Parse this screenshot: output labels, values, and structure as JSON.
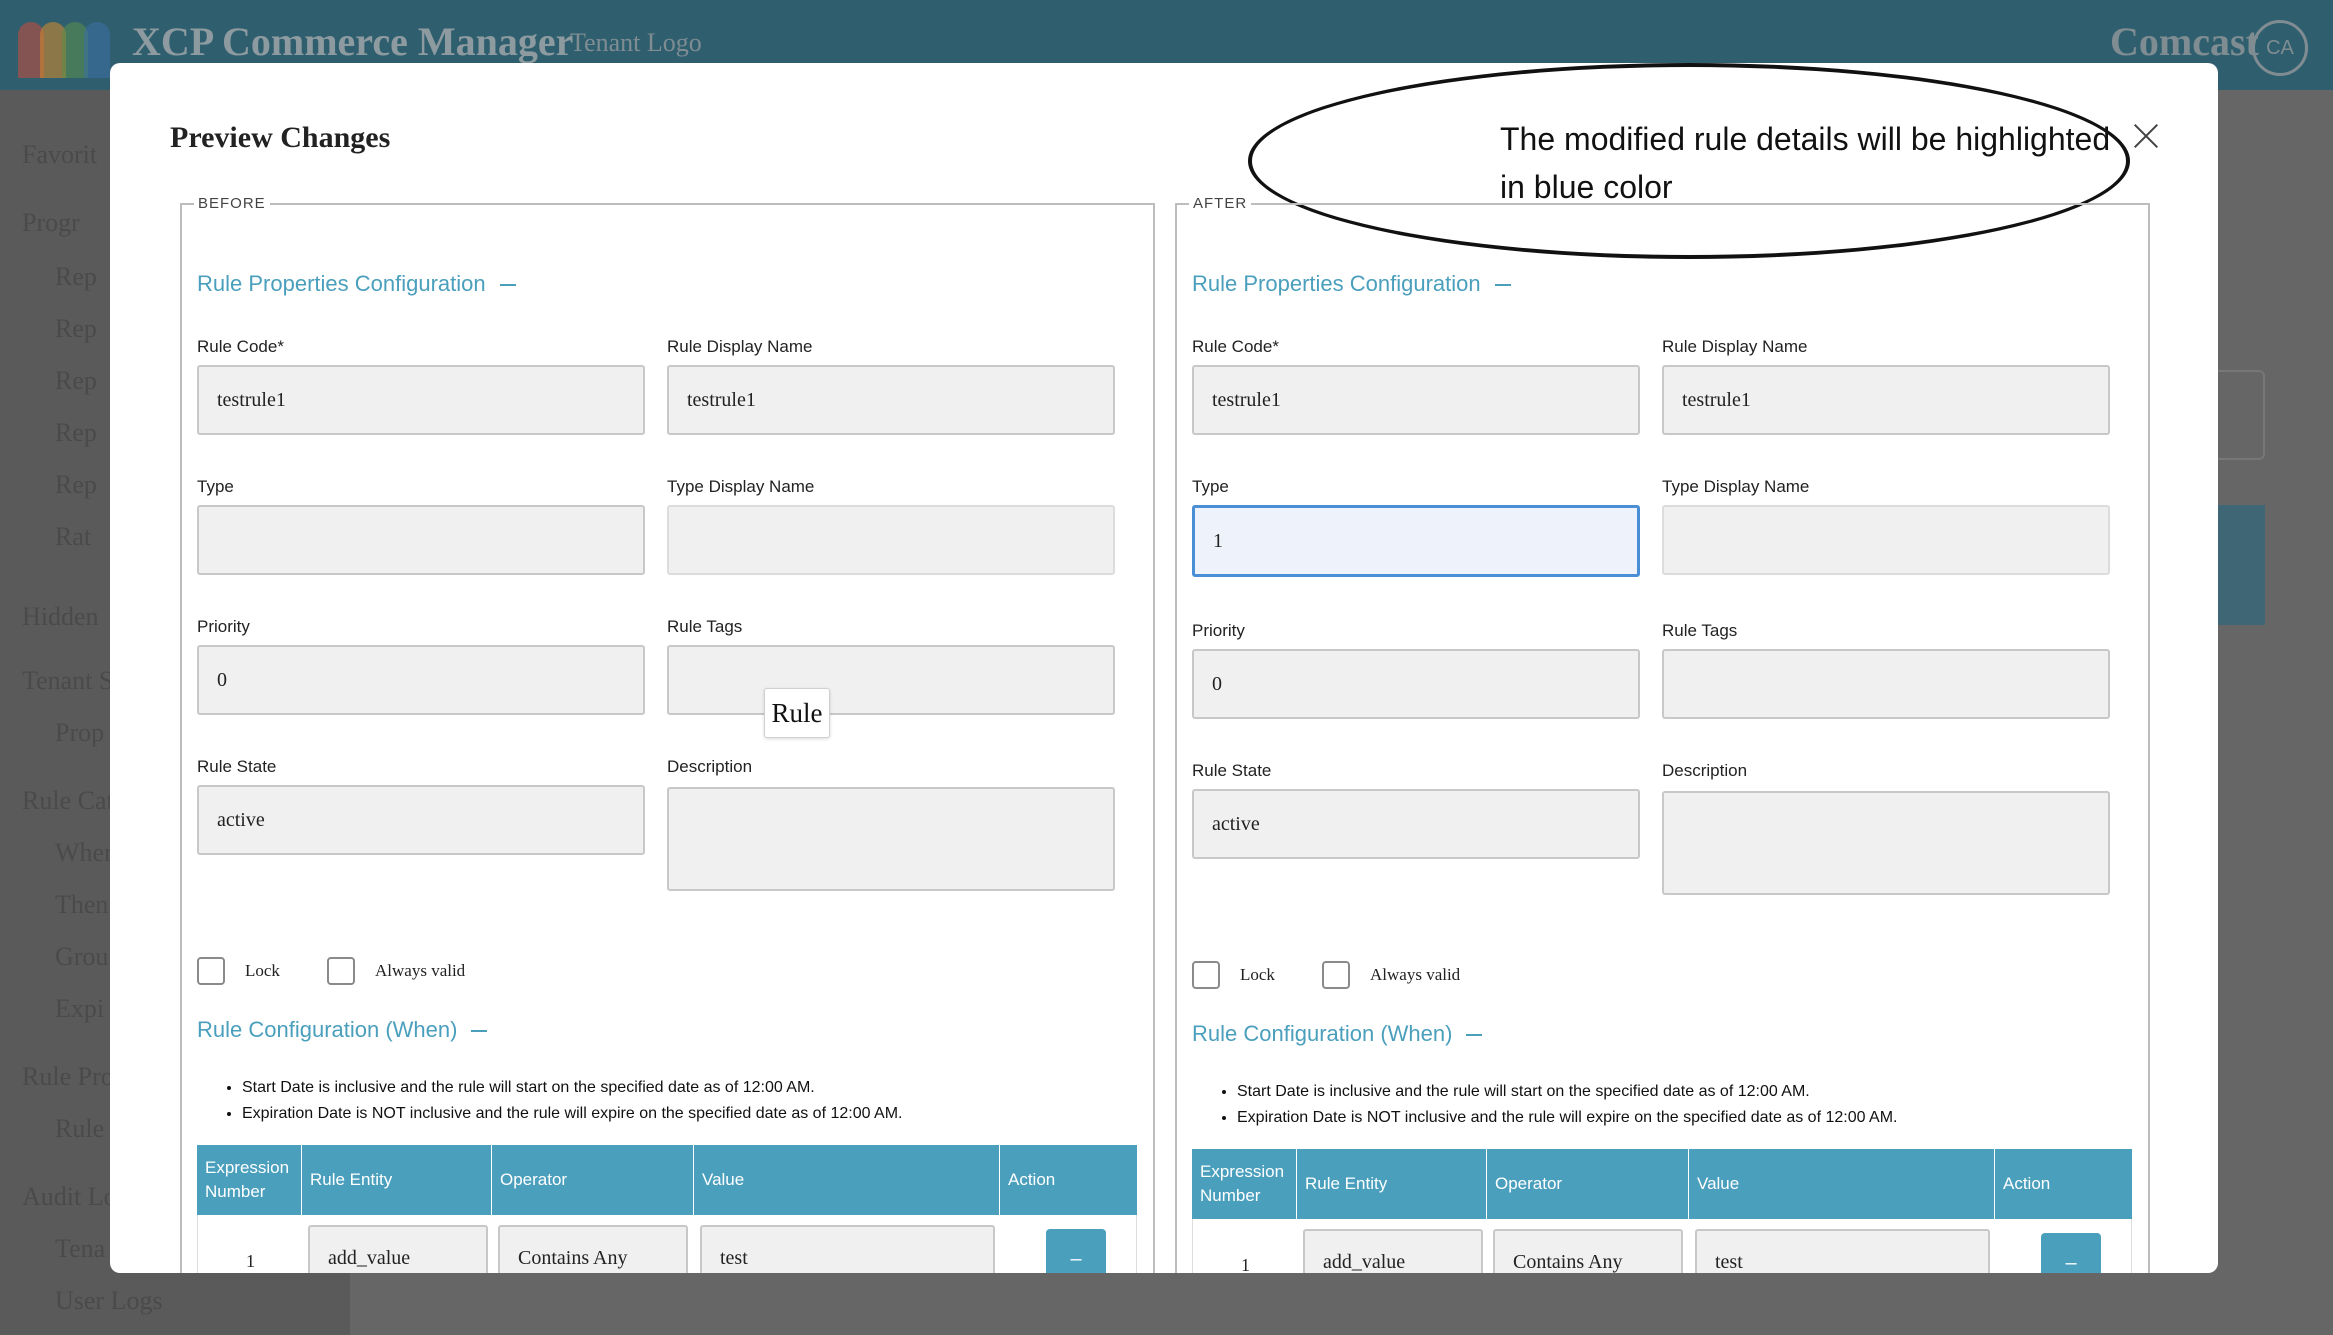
{
  "app": {
    "title": "XCP Commerce Manager",
    "header_link": "Tenant Logo",
    "brand": "Comcast",
    "avatar": "CA",
    "sidebar_items": [
      "Favorit",
      "Progr",
      "Rep",
      "Rep",
      "Rep",
      "Rep",
      "Rep",
      "Rat",
      "Hidden",
      "Tenant S",
      "Prop",
      "Rule Cat",
      "Wher",
      "Then",
      "Grou",
      "Expi",
      "Rule Pro",
      "Rule",
      "Audit Lo",
      "Tena",
      "User Logs"
    ]
  },
  "modal": {
    "title": "Preview Changes",
    "callout": "The modified rule details will be highlighted in blue color",
    "tooltip": "Rule"
  },
  "panes": {
    "before": {
      "legend": "BEFORE",
      "section_properties": "Rule Properties Configuration",
      "labels": {
        "rule_code": "Rule Code*",
        "rule_display_name": "Rule Display Name",
        "type": "Type",
        "type_display_name": "Type Display Name",
        "priority": "Priority",
        "rule_tags": "Rule Tags",
        "rule_state": "Rule State",
        "description": "Description",
        "lock": "Lock",
        "always_valid": "Always valid"
      },
      "values": {
        "rule_code": "testrule1",
        "rule_display_name": "testrule1",
        "type": "",
        "type_display_name": "",
        "priority": "0",
        "rule_tags": "",
        "rule_state": "active",
        "description": ""
      },
      "section_when": "Rule Configuration (When)",
      "notes": [
        "Start Date is inclusive and the rule will start on the specified date as of 12:00 AM.",
        "Expiration Date is NOT inclusive and the rule will expire on the specified date as of 12:00 AM."
      ],
      "table": {
        "headers": [
          "Expression Number",
          "Rule Entity",
          "Operator",
          "Value",
          "Action"
        ],
        "rows": [
          {
            "number": "1",
            "entity": "add_value",
            "operator": "Contains Any",
            "value": "test",
            "action": "–"
          }
        ]
      }
    },
    "after": {
      "legend": "AFTER",
      "section_properties": "Rule Properties Configuration",
      "labels": {
        "rule_code": "Rule Code*",
        "rule_display_name": "Rule Display Name",
        "type": "Type",
        "type_display_name": "Type Display Name",
        "priority": "Priority",
        "rule_tags": "Rule Tags",
        "rule_state": "Rule State",
        "description": "Description",
        "lock": "Lock",
        "always_valid": "Always valid"
      },
      "values": {
        "rule_code": "testrule1",
        "rule_display_name": "testrule1",
        "type": "1",
        "type_display_name": "",
        "priority": "0",
        "rule_tags": "",
        "rule_state": "active",
        "description": ""
      },
      "section_when": "Rule Configuration (When)",
      "notes": [
        "Start Date is inclusive and the rule will start on the specified date as of 12:00 AM.",
        "Expiration Date is NOT inclusive and the rule will expire on the specified date as of 12:00 AM."
      ],
      "table": {
        "headers": [
          "Expression Number",
          "Rule Entity",
          "Operator",
          "Value",
          "Action"
        ],
        "rows": [
          {
            "number": "1",
            "entity": "add_value",
            "operator": "Contains Any",
            "value": "test",
            "action": "–"
          }
        ]
      }
    }
  },
  "colors": {
    "accent": "#4a9fbd",
    "highlight": "#4a8fd6",
    "header_bg": "#2f5f6e"
  }
}
